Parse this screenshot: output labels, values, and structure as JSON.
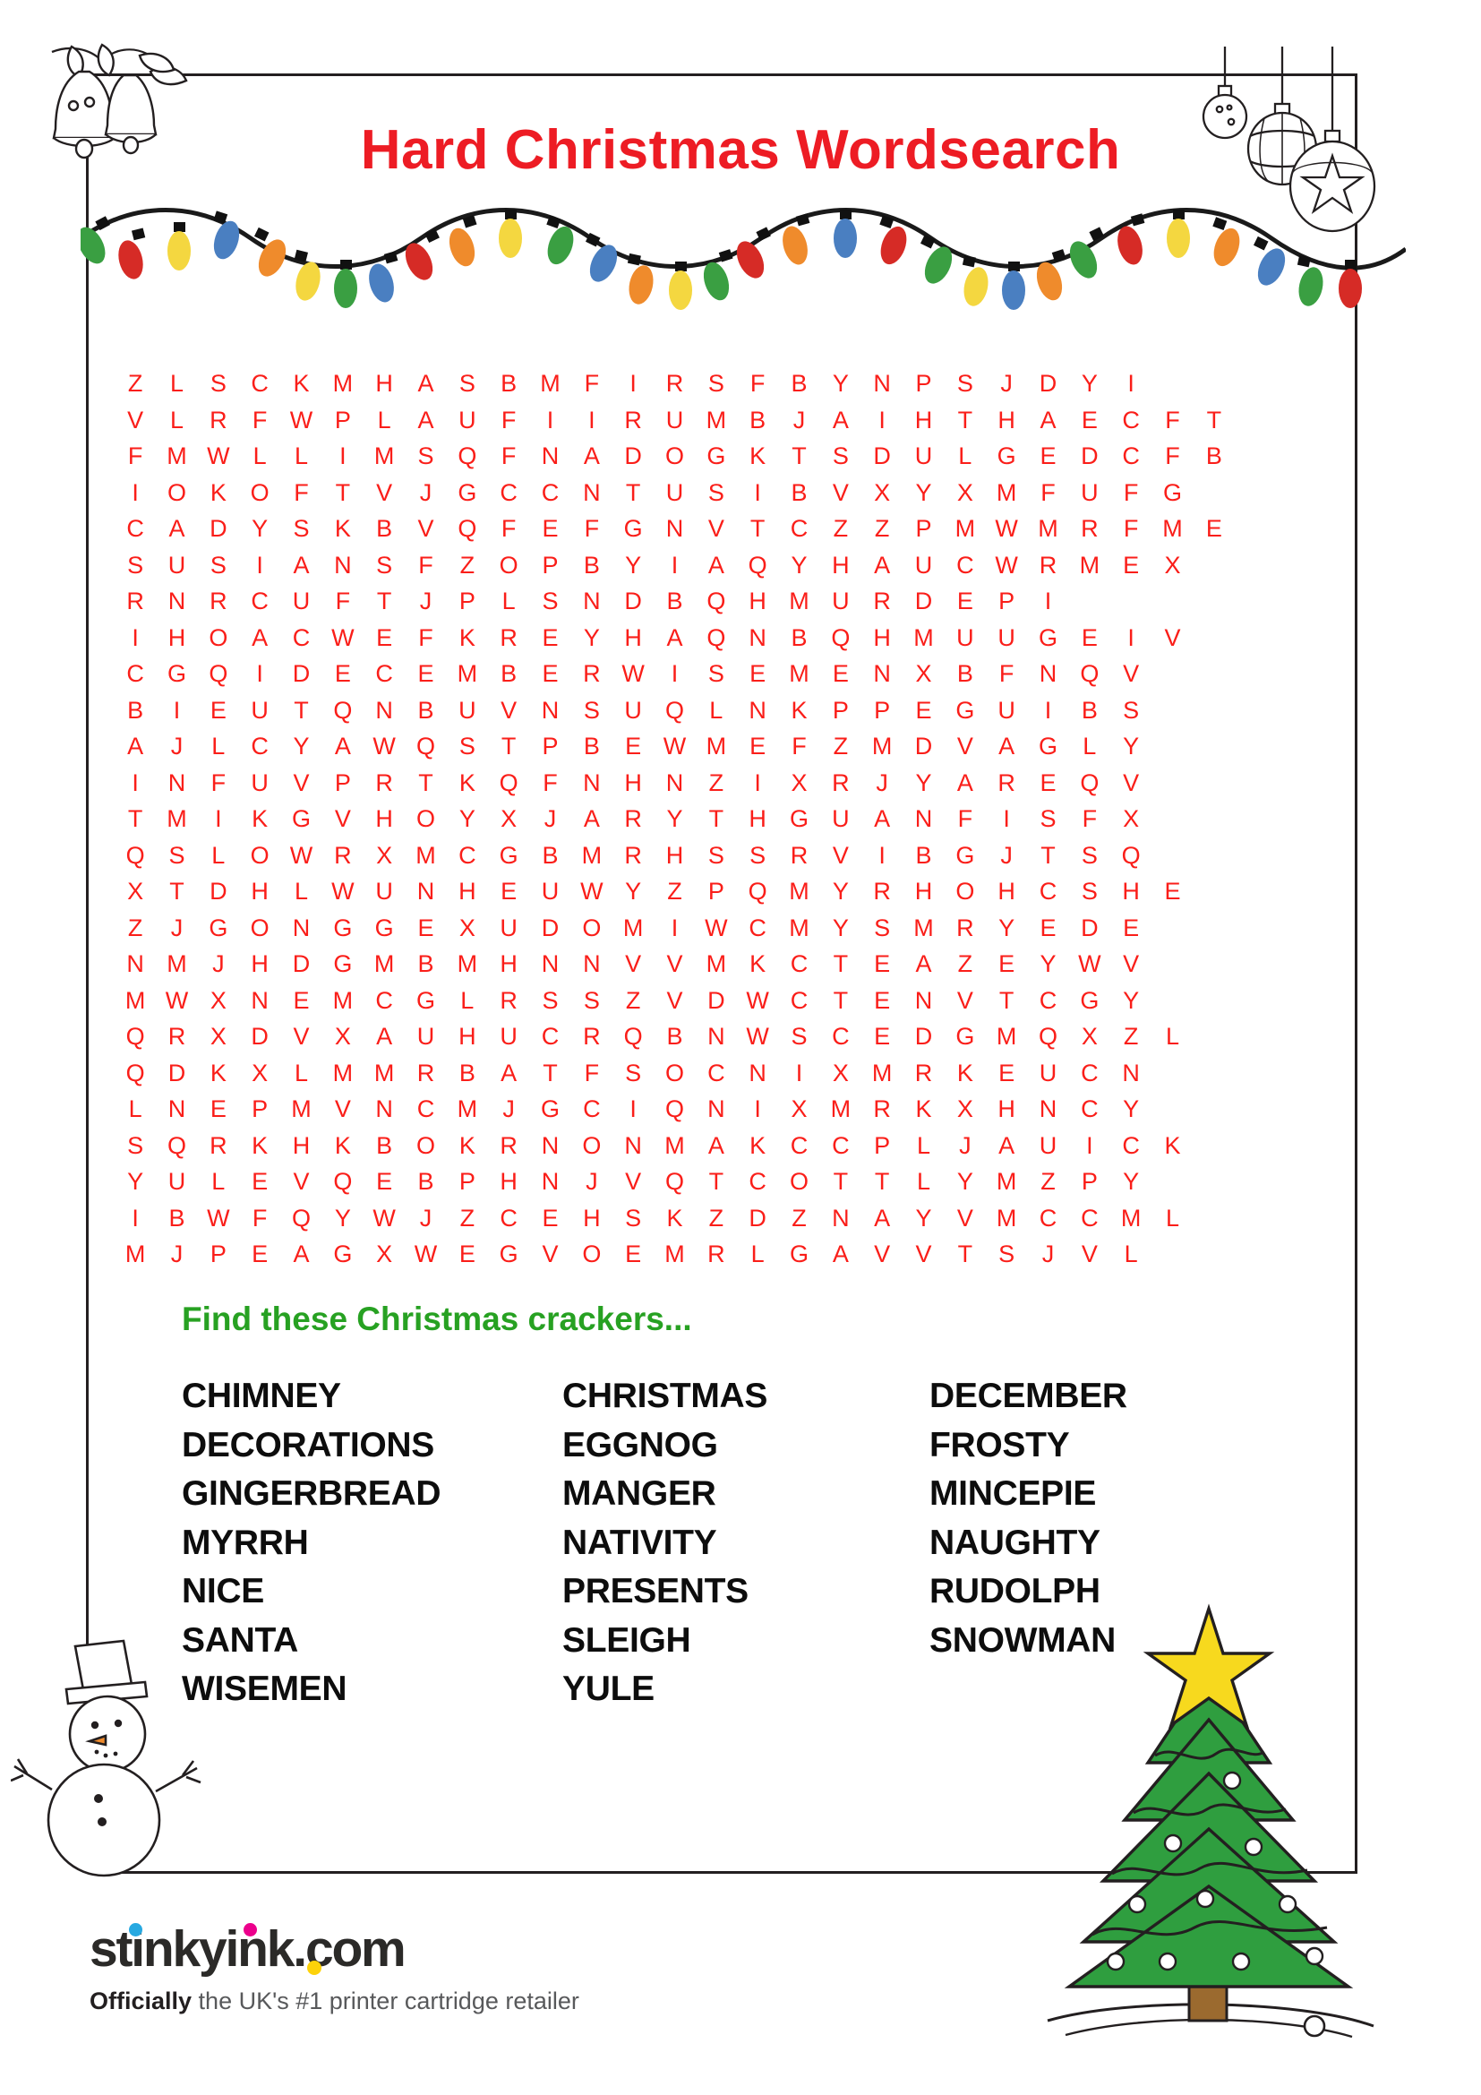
{
  "page": {
    "title": "Hard Christmas Wordsearch",
    "title_color": "#ed1c24",
    "find_heading": "Find these Christmas crackers...",
    "find_heading_color": "#27a122",
    "grid_letter_color": "#fa1e19",
    "grid_columns": 30,
    "grid_rows": 26
  },
  "grid": {
    "rows": [
      "ZLSCKMHASBMFIRSFBYNPSJDYI",
      "VLRFWPLAUFIIRUMBJAIHTHAECFT",
      "FMWLLIMSQFNADOGKTSDULGEDCFB",
      "IOKOFTVJGCCNTUSIBVXYXMFUFG",
      "CADYSKBVQFEFGNVTCZZPMWMRFME",
      "SUSIANSFZOPBYIAQYHAUCWRMEX",
      "RNRCUFTJPLSNDBQHMURDEPI",
      "IHOACWEFKREYHAQNBQHMUUGEIV",
      "CGQIDECEMBERWISEMENXBFNQV",
      "BIEUTQNBUVNSUQLNKPPEGUIBS",
      "AJLCYAWQSTPBEWMEFZMDVAGLY",
      "INFUVPRTKQFNHNZIXRJYAREQV",
      "TMIKGVHOYXJARYTHGUANFISFX",
      "QSLOWRXMCGBMRHSSRVIBGJTSQ",
      "XTDHLWUNHEUWYZPQMYRHOHCSHE",
      "ZJGONGGEXUDOMIWCMYSMRYEDE",
      "NMJHDGMBMHNNVVMKCTEAZEYWV",
      "MWXNEMCGLRSSZVDWCTENVTCGY",
      "QRXDVXAUHUCRQBNWSCEDGMQXZL",
      "QDKXLMMRBATFSOCNIXMRKEUCN",
      "LNEPMVNCMJGCIQNIXMRKXHNCY",
      "SQRKHKBOKRNONMAKCCPLJAUICK",
      "YULEVQEBPHNJVQTCOTTLYMZPY",
      "IBWFQYWJZCEHSKZDZNAYVMCCML",
      "MJPEAGXWEGVOEMRLGAVVTSJVL"
    ]
  },
  "words": {
    "column1": [
      "CHIMNEY",
      "DECORATIONS",
      "GINGERBREAD",
      "MYRRH",
      "NICE",
      "SANTA",
      "WISEMEN"
    ],
    "column2": [
      "CHRISTMAS",
      "EGGNOG",
      "MANGER",
      "NATIVITY",
      "PRESENTS",
      "SLEIGH",
      "YULE"
    ],
    "column3": [
      "DECEMBER",
      "FROSTY",
      "MINCEPIE",
      "NAUGHTY",
      "RUDOLPH",
      "SNOWMAN"
    ]
  },
  "footer": {
    "logo_part1": "stinkyink",
    "logo_dot": ".",
    "logo_part2": "com",
    "tagline_bold": "Officially",
    "tagline_rest": " the UK's #1 printer cartridge retailer",
    "colors": {
      "cyan": "#27a9e1",
      "magenta": "#ec008c",
      "yellow": "#fdd20a",
      "dark": "#2b2a28"
    }
  },
  "decorations": {
    "bells": "bells-icon",
    "baubles": "baubles-icon",
    "lights": "string-lights-icon",
    "snowman": "snowman-icon",
    "tree": "christmas-tree-icon"
  }
}
